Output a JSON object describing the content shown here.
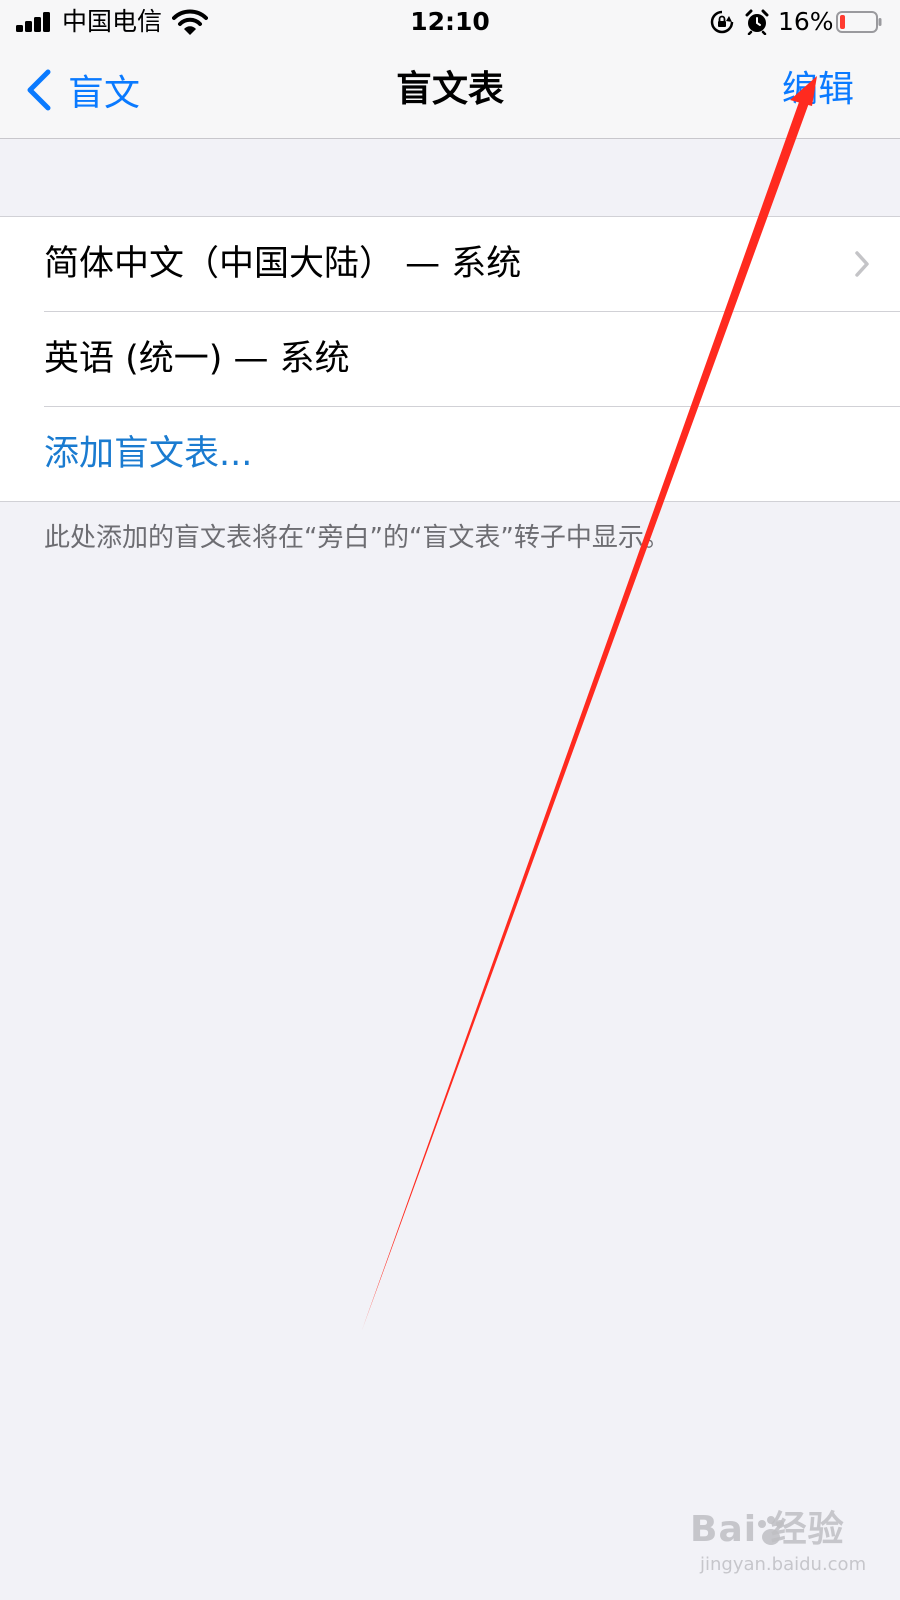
{
  "status_bar": {
    "carrier": "中国电信",
    "time": "12:10",
    "battery_percent": "16%",
    "battery_level": 0.16,
    "icons": [
      "signal-icon",
      "wifi-icon",
      "rotation-lock-icon",
      "alarm-icon",
      "battery-icon"
    ]
  },
  "nav": {
    "back_label": "盲文",
    "title": "盲文表",
    "edit_label": "编辑"
  },
  "list": {
    "items": [
      {
        "label": "简体中文（中国大陆） — 系统",
        "has_chevron": true
      },
      {
        "label": "英语 (统一) — 系统",
        "has_chevron": false
      }
    ],
    "add_label": "添加盲文表..."
  },
  "footnote": "此处添加的盲文表将在“旁白”的“盲文表”转子中显示。",
  "colors": {
    "accent": "#0a7aff",
    "link": "#1a7bd0",
    "background": "#f2f2f7",
    "annotation": "#ff2a1f"
  },
  "watermark": {
    "logo": "Bai  经验",
    "sub": "jingyan.baidu.com"
  }
}
